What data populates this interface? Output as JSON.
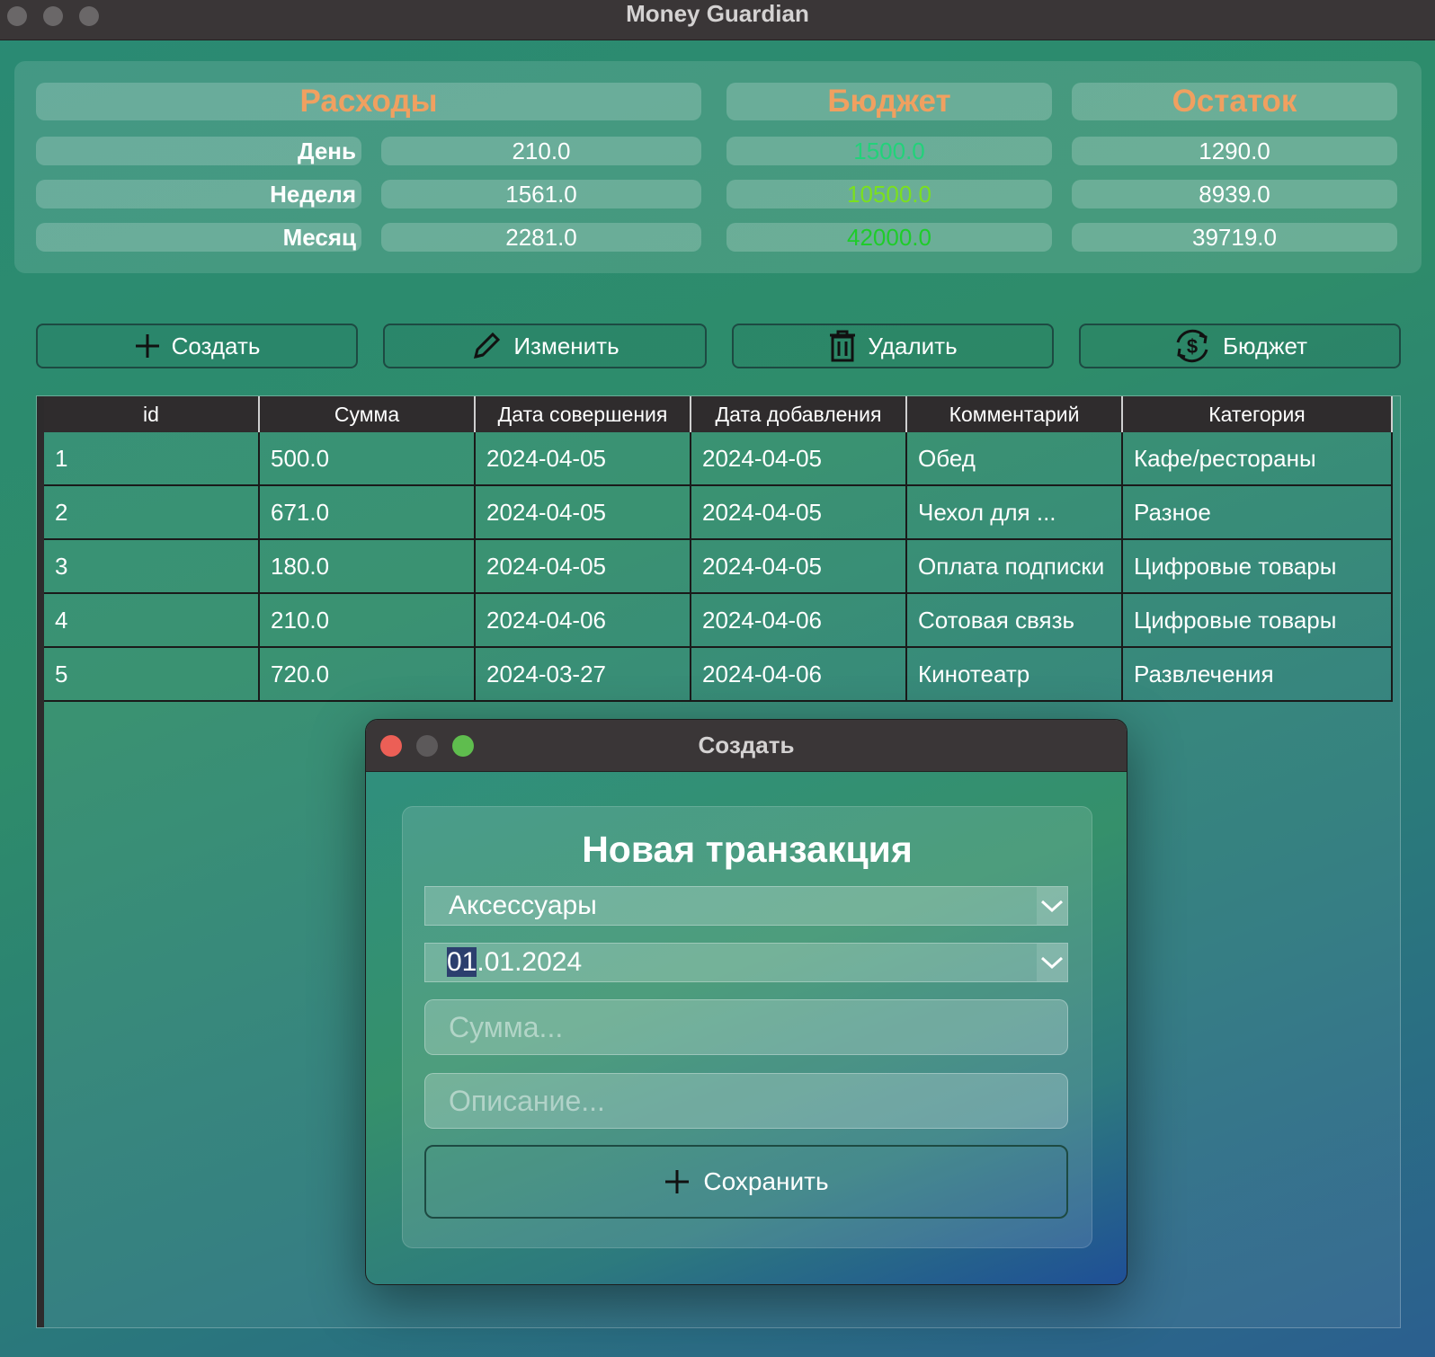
{
  "window": {
    "title": "Money Guardian",
    "traffic_lights": [
      "close-dot",
      "minimize-dot",
      "zoom-dot"
    ]
  },
  "summary": {
    "headers": {
      "expenses": "Расходы",
      "budget": "Бюджет",
      "remainder": "Остаток"
    },
    "header_color": "#f0a060",
    "rows": [
      {
        "label": "День",
        "expenses": "210.0",
        "budget": "1500.0",
        "remainder": "1290.0",
        "budget_color": "#22d27a"
      },
      {
        "label": "Неделя",
        "expenses": "1561.0",
        "budget": "10500.0",
        "remainder": "8939.0",
        "budget_color": "#7be01e"
      },
      {
        "label": "Месяц",
        "expenses": "2281.0",
        "budget": "42000.0",
        "remainder": "39719.0",
        "budget_color": "#1ecc2a"
      }
    ]
  },
  "toolbar": {
    "create": {
      "label": "Создать",
      "icon": "plus-icon"
    },
    "edit": {
      "label": "Изменить",
      "icon": "pencil-icon"
    },
    "delete": {
      "label": "Удалить",
      "icon": "trash-icon"
    },
    "budget": {
      "label": "Бюджет",
      "icon": "dollar-refresh-icon"
    }
  },
  "table": {
    "columns": [
      "id",
      "Сумма",
      "Дата совершения",
      "Дата добавления",
      "Комментарий",
      "Категория"
    ],
    "rows": [
      [
        "1",
        "500.0",
        "2024-04-05",
        "2024-04-05",
        "Обед",
        "Кафе/рестораны"
      ],
      [
        "2",
        "671.0",
        "2024-04-05",
        "2024-04-05",
        "Чехол для ...",
        "Разное"
      ],
      [
        "3",
        "180.0",
        "2024-04-05",
        "2024-04-05",
        "Оплата подписки",
        "Цифровые товары"
      ],
      [
        "4",
        "210.0",
        "2024-04-06",
        "2024-04-06",
        "Сотовая связь",
        "Цифровые товары"
      ],
      [
        "5",
        "720.0",
        "2024-03-27",
        "2024-04-06",
        "Кинотеатр",
        "Развлечения"
      ]
    ]
  },
  "dialog": {
    "title": "Создать",
    "traffic_light_colors": {
      "close": "#ec5f56",
      "minimize": "#5c595a",
      "zoom": "#5fbd4e"
    },
    "heading": "Новая транзакция",
    "category_selected": "Аксессуары",
    "date_selected_part": "01",
    "date_rest": ".01.2024",
    "amount_placeholder": "Сумма...",
    "description_placeholder": "Описание...",
    "save_label": "Сохранить",
    "save_icon": "plus-icon"
  }
}
